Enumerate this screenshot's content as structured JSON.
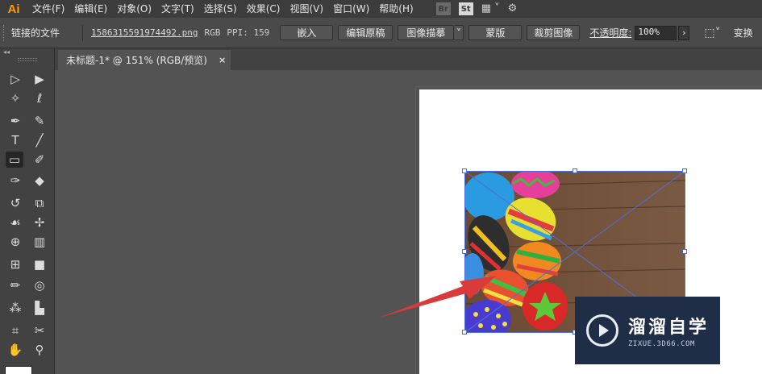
{
  "app": {
    "logo": "Ai"
  },
  "menu": [
    "文件(F)",
    "编辑(E)",
    "对象(O)",
    "文字(T)",
    "选择(S)",
    "效果(C)",
    "视图(V)",
    "窗口(W)",
    "帮助(H)"
  ],
  "menubar_badges": {
    "br": "Br",
    "st": "St",
    "workspace_icon": "workspace-grid-icon",
    "sync_icon": "sync-icon"
  },
  "control_bar": {
    "linked_file_label": "链接的文件",
    "file_name": "1586315591974492.png",
    "color_mode": "RGB",
    "ppi": "PPI: 159",
    "embed_button": "嵌入",
    "edit_original_button": "编辑原稿",
    "image_trace_button": "图像描摹",
    "mask_button": "蒙版",
    "crop_button": "裁剪图像",
    "opacity_label": "不透明度:",
    "opacity_value": "100%",
    "transform_label": "变换"
  },
  "document_tab": {
    "title": "未标题-1* @ 151% (RGB/预览)",
    "close": "×"
  },
  "watermark": {
    "title": "溜溜自学",
    "url": "ZIXUE.3D66.COM"
  },
  "colors": {
    "accent_selection": "#4b6fe0",
    "artboard_border": "#c8312c",
    "annotation_arrow": "#d93a3a",
    "logo_orange": "#ff9a00"
  }
}
